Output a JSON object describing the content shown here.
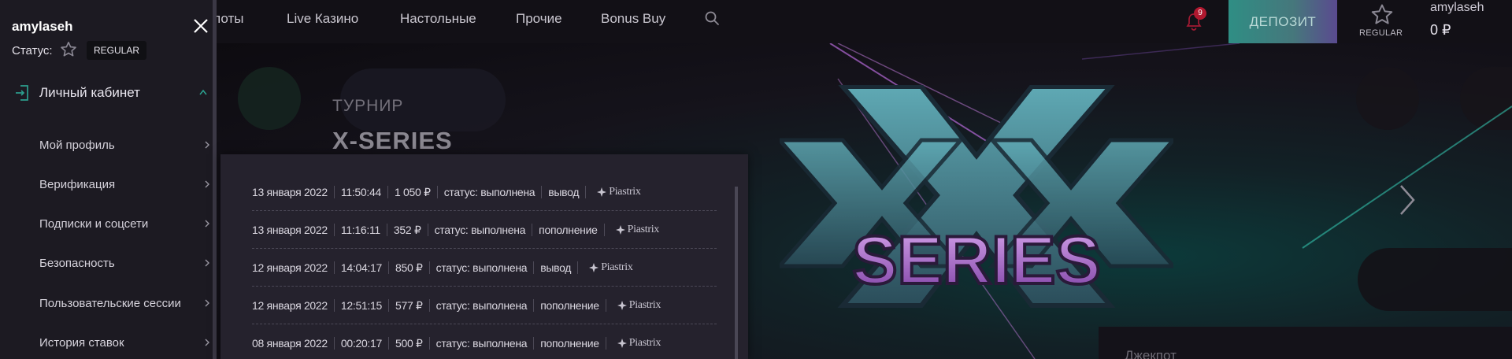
{
  "header": {
    "nav": [
      "Слоты",
      "Live Казино",
      "Настольные",
      "Прочие",
      "Bonus Buy"
    ],
    "notifications_count": "9",
    "deposit_label": "ДЕПОЗИТ",
    "level_label": "REGULAR",
    "username": "amylaseh",
    "balance": "0 ₽"
  },
  "sidebar": {
    "username": "amylaseh",
    "status_label": "Статус:",
    "status_badge": "REGULAR",
    "cabinet_label": "Личный кабинет",
    "items": [
      {
        "label": "Мой профиль"
      },
      {
        "label": "Верификация"
      },
      {
        "label": "Подписки и соцсети"
      },
      {
        "label": "Безопасность"
      },
      {
        "label": "Пользовательские сессии"
      },
      {
        "label": "История ставок"
      }
    ]
  },
  "banner": {
    "subtitle": "ТУРНИР",
    "title": "X-SERIES",
    "logo_text": "SERIES",
    "jackpot_label": "Джекпот"
  },
  "transactions": [
    {
      "date": "13 января 2022",
      "time": "11:50:44",
      "amount": "1 050 ₽",
      "status": "статус: выполнена",
      "type": "вывод",
      "provider": "Piastrix"
    },
    {
      "date": "13 января 2022",
      "time": "11:16:11",
      "amount": "352 ₽",
      "status": "статус: выполнена",
      "type": "пополнение",
      "provider": "Piastrix"
    },
    {
      "date": "12 января 2022",
      "time": "14:04:17",
      "amount": "850 ₽",
      "status": "статус: выполнена",
      "type": "вывод",
      "provider": "Piastrix"
    },
    {
      "date": "12 января 2022",
      "time": "12:51:15",
      "amount": "577 ₽",
      "status": "статус: выполнена",
      "type": "пополнение",
      "provider": "Piastrix"
    },
    {
      "date": "08 января 2022",
      "time": "00:20:17",
      "amount": "500 ₽",
      "status": "статус: выполнена",
      "type": "пополнение",
      "provider": "Piastrix"
    }
  ],
  "colors": {
    "accent_teal": "#2f8e84",
    "accent_purple": "#5a4a8f",
    "badge_red": "#b0182f",
    "sidebar_bg": "#1c1a22"
  },
  "icons": [
    "search-icon",
    "bell-icon",
    "star-icon",
    "close-icon",
    "login-icon",
    "chevron-up-icon",
    "chevron-right-icon",
    "arrow-right-icon",
    "piastrix-logo-icon"
  ]
}
